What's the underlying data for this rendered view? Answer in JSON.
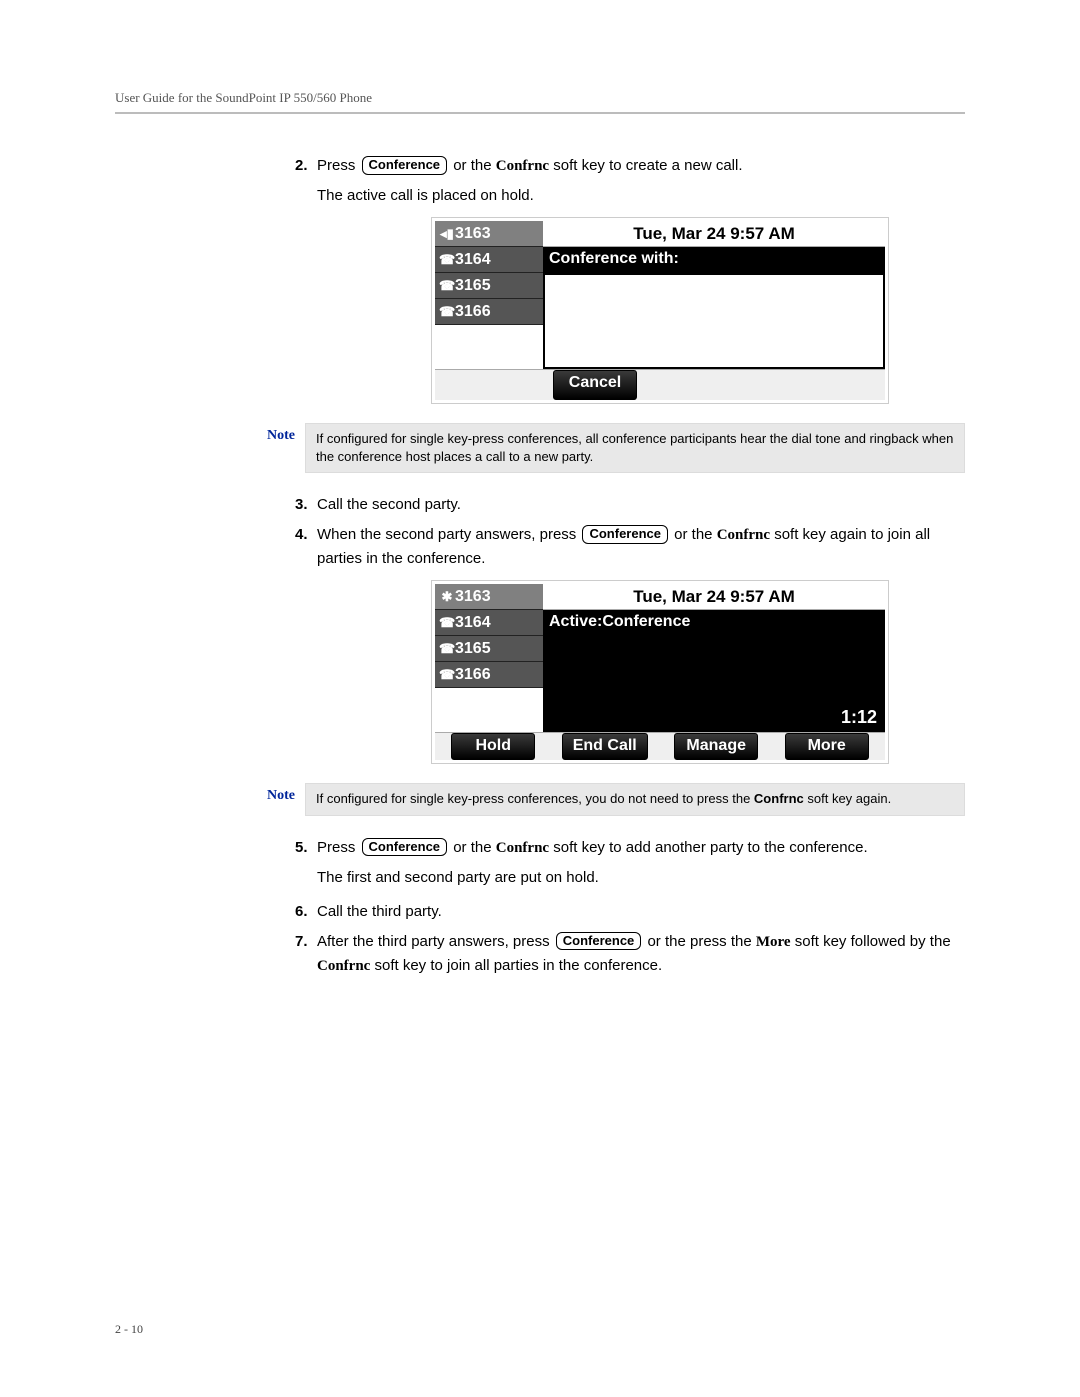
{
  "header": "User Guide for the SoundPoint IP 550/560 Phone",
  "page_num": "2 - 10",
  "conf_btn_label": "Conference",
  "steps": {
    "s2": {
      "num": "2.",
      "a": "Press ",
      "b": " or the ",
      "sk": "Confrnc",
      "c": " soft key to create a new call."
    },
    "s2_sub": "The active call is placed on hold.",
    "s3": {
      "num": "3.",
      "text": "Call the second party."
    },
    "s4": {
      "num": "4.",
      "a": "When the second party answers, press ",
      "b": " or the ",
      "sk": "Confrnc",
      "c": " soft key again to join all parties in the conference."
    },
    "s5": {
      "num": "5.",
      "a": "Press ",
      "b": " or the ",
      "sk": "Confrnc",
      "c": " soft key to add another party to the conference."
    },
    "s5_sub": "The first and second party are put on hold.",
    "s6": {
      "num": "6.",
      "text": "Call the third party."
    },
    "s7": {
      "num": "7.",
      "a": "After the third party answers, press ",
      "b": " or the press the ",
      "sk1": "More",
      "c": " soft key followed by the ",
      "sk2": "Confrnc",
      "d": " soft key to join all parties in the conference."
    }
  },
  "notes": {
    "label": "Note",
    "n1": "If configured for single key-press conferences, all conference participants hear the dial tone and ringback when the conference host places a call to a new party.",
    "n2_a": "If configured for single key-press conferences, you do not need to press the ",
    "n2_b": "Confrnc",
    "n2_c": " soft key again."
  },
  "phone1": {
    "lines": [
      "3163",
      "3164",
      "3165",
      "3166"
    ],
    "datetime": "Tue, Mar 24  9:57 AM",
    "title": "Conference with:",
    "softkeys": [
      "Cancel"
    ]
  },
  "phone2": {
    "lines": [
      "3163",
      "3164",
      "3165",
      "3166"
    ],
    "datetime": "Tue, Mar 24  9:57 AM",
    "title": "Active:Conference",
    "timer": "1:12",
    "softkeys": [
      "Hold",
      "End Call",
      "Manage",
      "More"
    ]
  }
}
